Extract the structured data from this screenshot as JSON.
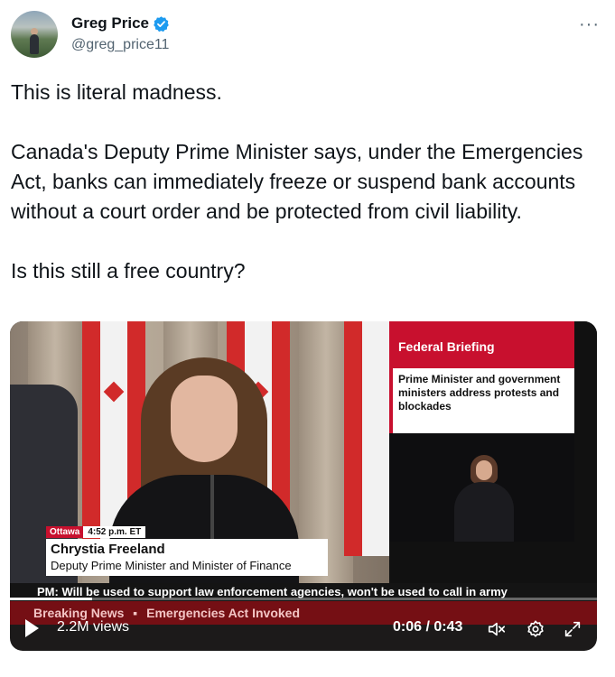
{
  "tweet": {
    "author_name": "Greg Price",
    "handle": "@greg_price11",
    "more_glyph": "···",
    "paragraphs": [
      "This is literal madness.",
      "Canada's Deputy Prime Minister says, under the Emergencies Act, banks can immediately freeze or suspend bank accounts without a court order and be protected from civil liability.",
      "Is this still a free country?"
    ]
  },
  "video": {
    "side_panel_title": "Federal Briefing",
    "side_panel_text": "Prime Minister and government ministers address protests and blockades",
    "location": "Ottawa",
    "time": "4:52 p.m. ET",
    "speaker_name": "Chrystia Freeland",
    "speaker_title": "Deputy Prime Minister and Minister of Finance",
    "ticker": "PM: Will be used to support law enforcement agencies, won't be used to call in army",
    "breaking_label": "Breaking News",
    "breaking_separator": "▪",
    "breaking_headline": "Emergencies Act Invoked",
    "views": "2.2M views",
    "current_time": "0:06",
    "duration": "0:43",
    "progress_fraction": 0.14
  },
  "colors": {
    "verified": "#1d9bf0",
    "cbc_red": "#c8102e"
  },
  "icons": [
    "verified-badge-icon",
    "more-icon",
    "play-icon",
    "mute-icon",
    "settings-icon",
    "fullscreen-icon"
  ]
}
